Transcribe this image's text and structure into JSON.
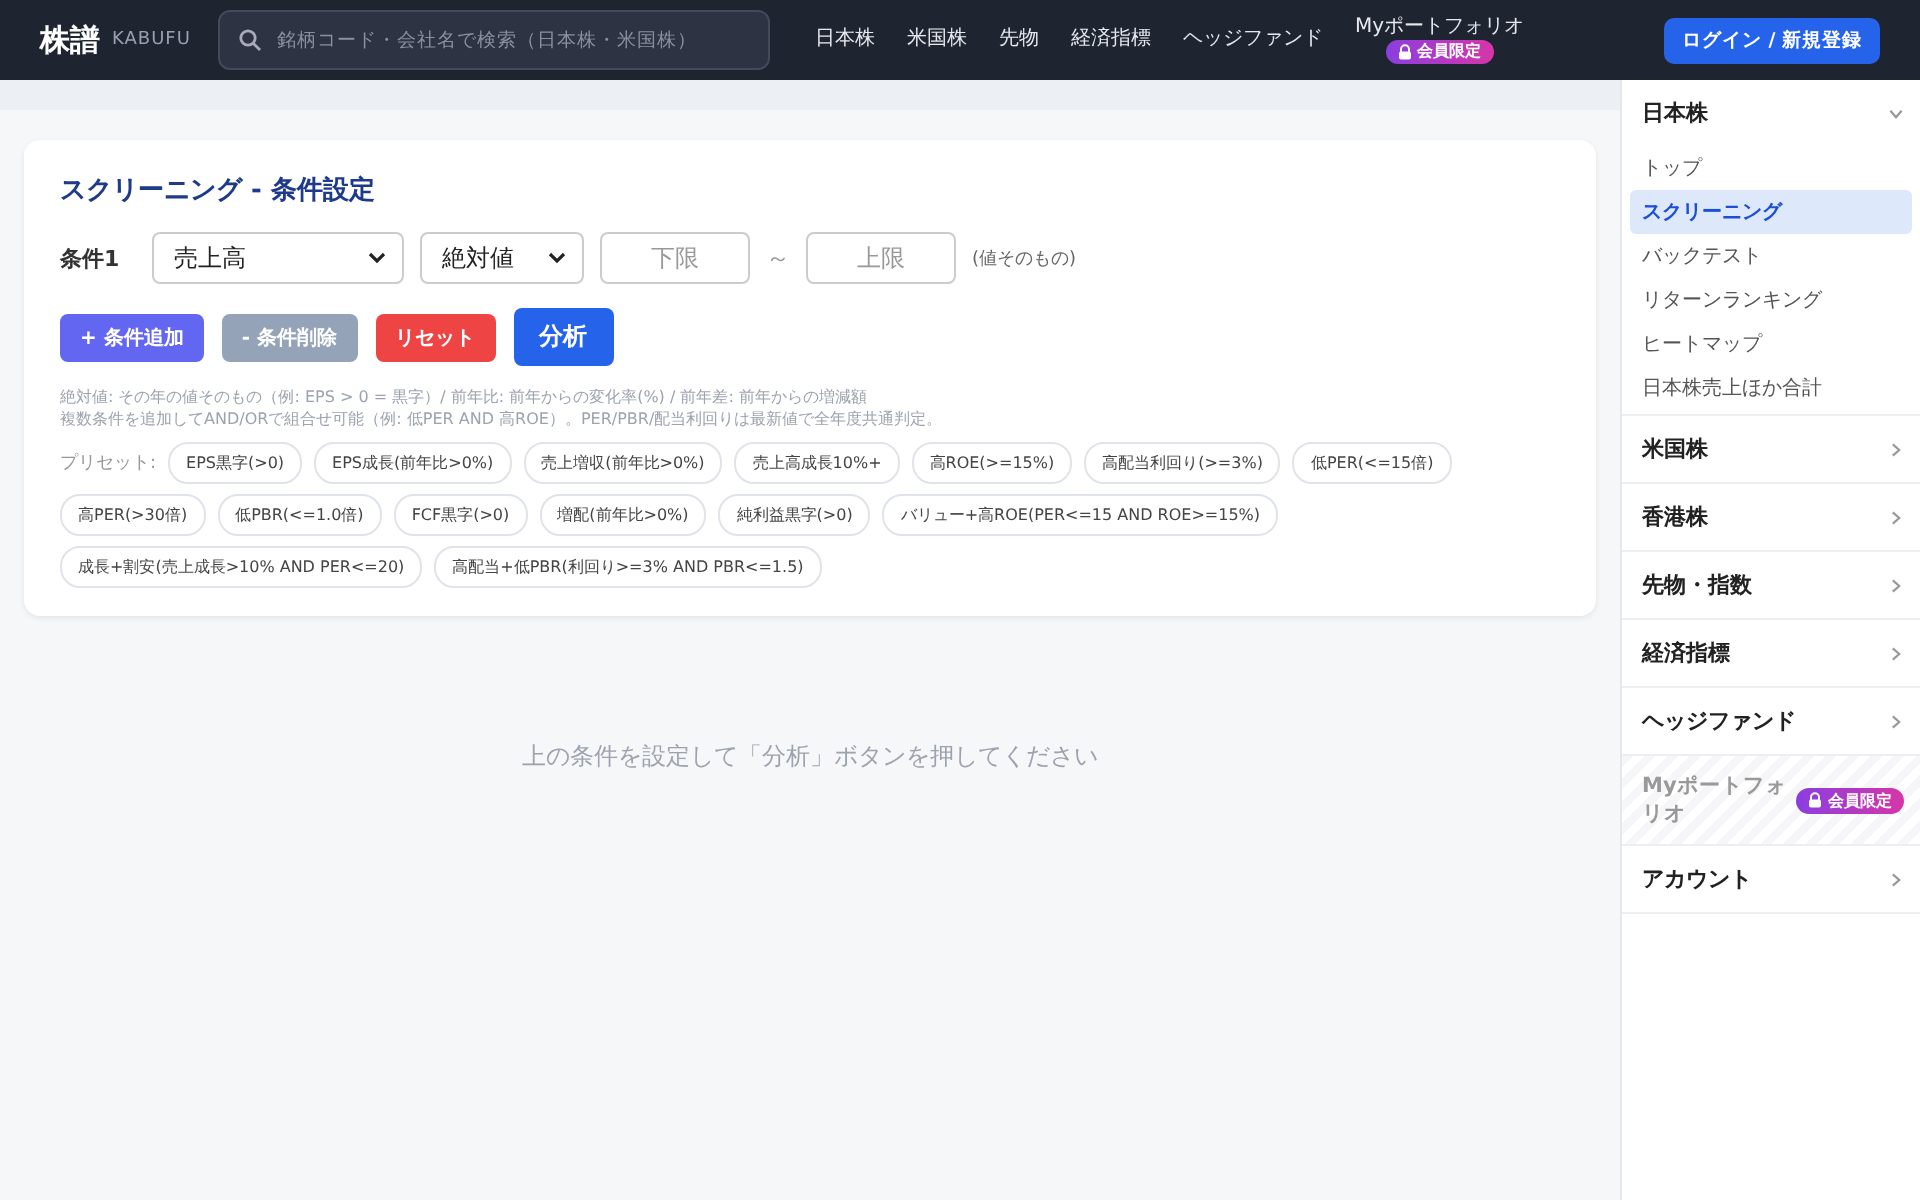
{
  "header": {
    "logo": "株譜",
    "logo_sub": "KABUFU",
    "search": {
      "placeholder": "銘柄コード・会社名で検索（日本株・米国株）"
    },
    "nav": [
      {
        "label": "日本株"
      },
      {
        "label": "米国株"
      },
      {
        "label": "先物"
      },
      {
        "label": "経済指標"
      },
      {
        "label": "ヘッジファンド"
      },
      {
        "label": "Myポートフォリオ",
        "badge": "会員限定"
      }
    ],
    "login": "ログイン / 新規登録"
  },
  "card": {
    "title": "スクリーニング - 条件設定",
    "conditions": [
      {
        "label": "条件1",
        "metric": "売上高",
        "mode": "絶対値",
        "lower": {
          "placeholder": "下限"
        },
        "tilde": "～",
        "upper": {
          "placeholder": "上限"
        },
        "note": "(値そのもの)"
      }
    ],
    "buttons": [
      {
        "kind": "add",
        "label": "+ 条件追加"
      },
      {
        "kind": "remove",
        "label": "- 条件削除"
      },
      {
        "kind": "reset",
        "label": "リセット"
      },
      {
        "kind": "analyze",
        "label": "分析"
      }
    ],
    "help": [
      "絶対値: その年の値そのもの（例: EPS > 0 = 黒字）/ 前年比: 前年からの変化率(%) / 前年差: 前年からの増減額",
      "複数条件を追加してAND/ORで組合せ可能（例: 低PER AND 高ROE）。PER/PBR/配当利回りは最新値で全年度共通判定。"
    ],
    "presets_label": "プリセット:",
    "presets": [
      "EPS黒字(>0)",
      "EPS成長(前年比>0%)",
      "売上増収(前年比>0%)",
      "売上高成長10%+",
      "高ROE(>=15%)",
      "高配当利回り(>=3%)",
      "低PER(<=15倍)",
      "高PER(>30倍)",
      "低PBR(<=1.0倍)",
      "FCF黒字(>0)",
      "増配(前年比>0%)",
      "純利益黒字(>0)",
      "バリュー+高ROE(PER<=15 AND ROE>=15%)",
      "成長+割安(売上成長>10% AND PER<=20)",
      "高配当+低PBR(利回り>=3% AND PBR<=1.5)"
    ]
  },
  "empty_message": "上の条件を設定して「分析」ボタンを押してください",
  "sidebar": [
    {
      "kind": "group",
      "label": "日本株",
      "expanded": true,
      "items": [
        {
          "label": "トップ",
          "selected": false
        },
        {
          "label": "スクリーニング",
          "selected": true
        },
        {
          "label": "バックテスト",
          "selected": false
        },
        {
          "label": "リターンランキング",
          "selected": false
        },
        {
          "label": "ヒートマップ",
          "selected": false
        },
        {
          "label": "日本株売上ほか合計",
          "selected": false
        }
      ]
    },
    {
      "kind": "group",
      "label": "米国株",
      "expanded": false
    },
    {
      "kind": "group",
      "label": "香港株",
      "expanded": false
    },
    {
      "kind": "group",
      "label": "先物・指数",
      "expanded": false
    },
    {
      "kind": "group",
      "label": "経済指標",
      "expanded": false
    },
    {
      "kind": "group",
      "label": "ヘッジファンド",
      "expanded": false
    },
    {
      "kind": "locked",
      "label": "Myポートフォリオ",
      "badge": "会員限定"
    },
    {
      "kind": "group",
      "label": "アカウント",
      "expanded": false
    }
  ]
}
